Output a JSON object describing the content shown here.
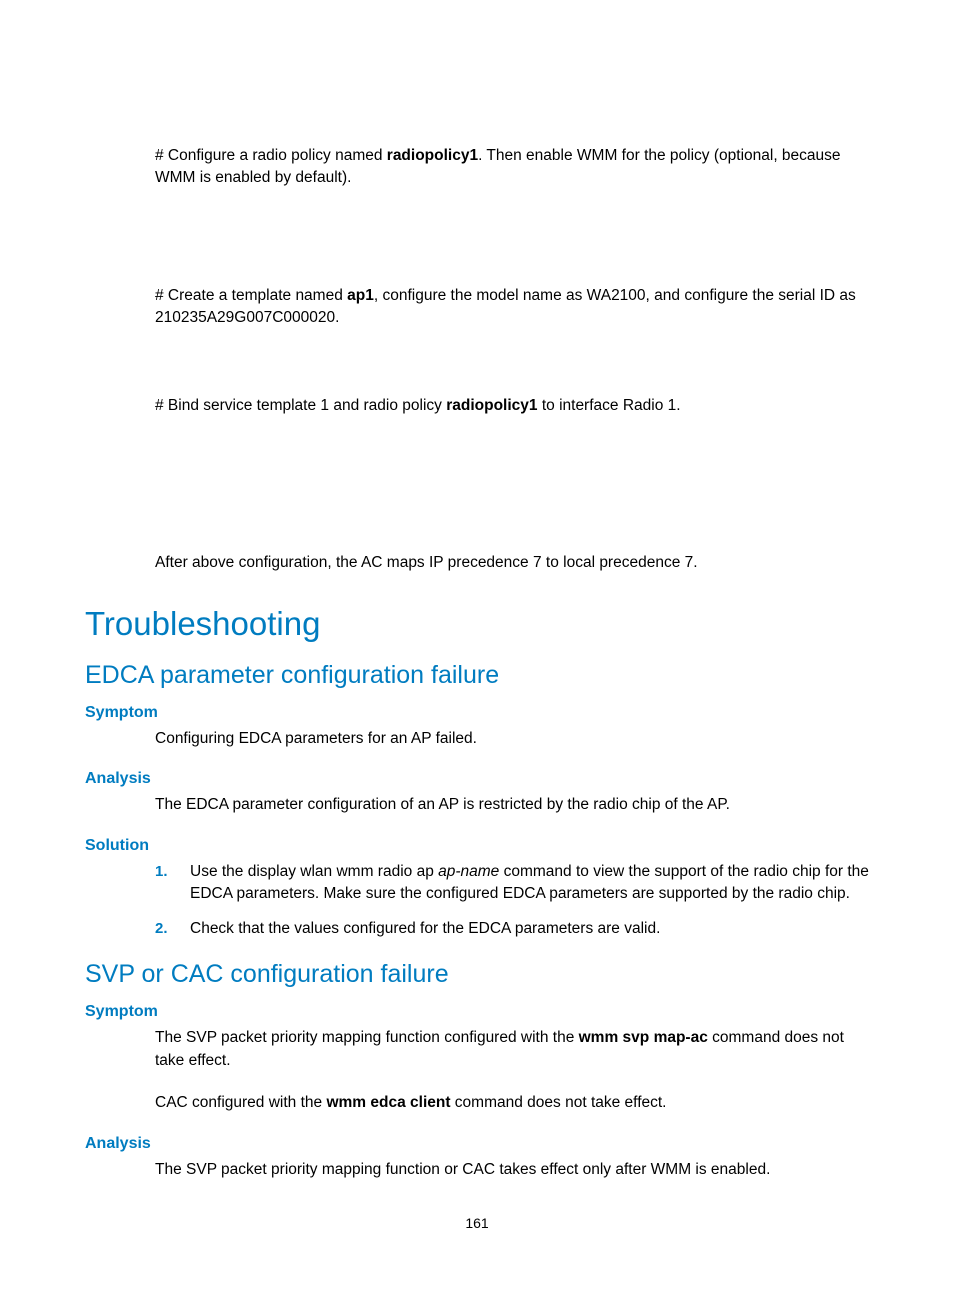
{
  "para1_a": "# Configure a radio policy named ",
  "para1_bold": "radiopolicy1",
  "para1_b": ". Then enable WMM for the policy (optional, because WMM is enabled by default).",
  "para2_a": "# Create a template named ",
  "para2_bold": "ap1",
  "para2_b": ", configure the model name as WA2100, and configure the serial ID as 210235A29G007C000020.",
  "para3_a": "# Bind service template 1 and radio policy ",
  "para3_bold": "radiopolicy1",
  "para3_b": " to interface Radio 1.",
  "para4": "After above configuration, the AC maps IP precedence 7 to local precedence 7.",
  "h1": "Troubleshooting",
  "sec1": {
    "h2": "EDCA parameter configuration failure",
    "symptom_h": "Symptom",
    "symptom_p": "Configuring EDCA parameters for an AP failed.",
    "analysis_h": "Analysis",
    "analysis_p": "The EDCA parameter configuration of an AP is restricted by the radio chip of the AP.",
    "solution_h": "Solution",
    "sol1_a": "Use the ",
    "sol1_bold": "display wlan wmm radio ap",
    "sol1_it": " ap-name",
    "sol1_b": " command to view the support of the radio chip for the EDCA parameters. Make sure the configured EDCA parameters are supported by the radio chip.",
    "sol2": "Check that the values configured for the EDCA parameters are valid."
  },
  "sec2": {
    "h2": "SVP or CAC configuration failure",
    "symptom_h": "Symptom",
    "symptom_p1_a": "The SVP packet priority mapping function configured with the ",
    "symptom_p1_bold": "wmm svp map-ac",
    "symptom_p1_b": " command does not take effect.",
    "symptom_p2_a": "CAC configured with the ",
    "symptom_p2_bold": "wmm edca client",
    "symptom_p2_b": " command does not take effect.",
    "analysis_h": "Analysis",
    "analysis_p": "The SVP packet priority mapping function or CAC takes effect only after WMM is enabled."
  },
  "page_number": "161"
}
